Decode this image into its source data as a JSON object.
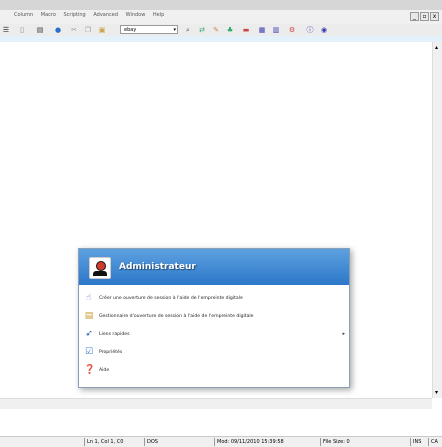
{
  "menubar": {
    "items": [
      "Column",
      "Macro",
      "Scripting",
      "Advanced",
      "Window",
      "Help"
    ]
  },
  "mdi_controls": [
    "_",
    "▫",
    "x"
  ],
  "toolbar": {
    "combo_value": "ebay"
  },
  "statusbar": {
    "position": "Ln 1, Col 1, C0",
    "format": "DOS",
    "modified": "Mod: 09/11/2010 15:39:58",
    "filesize": "File Size: 0",
    "mode": "INS",
    "mode2": "CA"
  },
  "popup": {
    "user": "Administrateur",
    "items": [
      {
        "label": "Créer une ouverture de session à l'aide de l'empreinte digitale",
        "icon": "fingerprint-icon",
        "color": "#5a7fb5"
      },
      {
        "label": "Gestionnaire d'ouverture de session à l'aide de l'empreinte digitale",
        "icon": "fingerprint-manager-icon",
        "color": "#c49a2a"
      },
      {
        "label": "Liens rapides",
        "icon": "quick-links-icon",
        "color": "#1f5fa8",
        "has_submenu": true
      },
      {
        "label": "Propriétés",
        "icon": "properties-icon",
        "color": "#3c78c8"
      },
      {
        "label": "Aide",
        "icon": "help-icon",
        "color": "#2a6fc9"
      }
    ]
  }
}
